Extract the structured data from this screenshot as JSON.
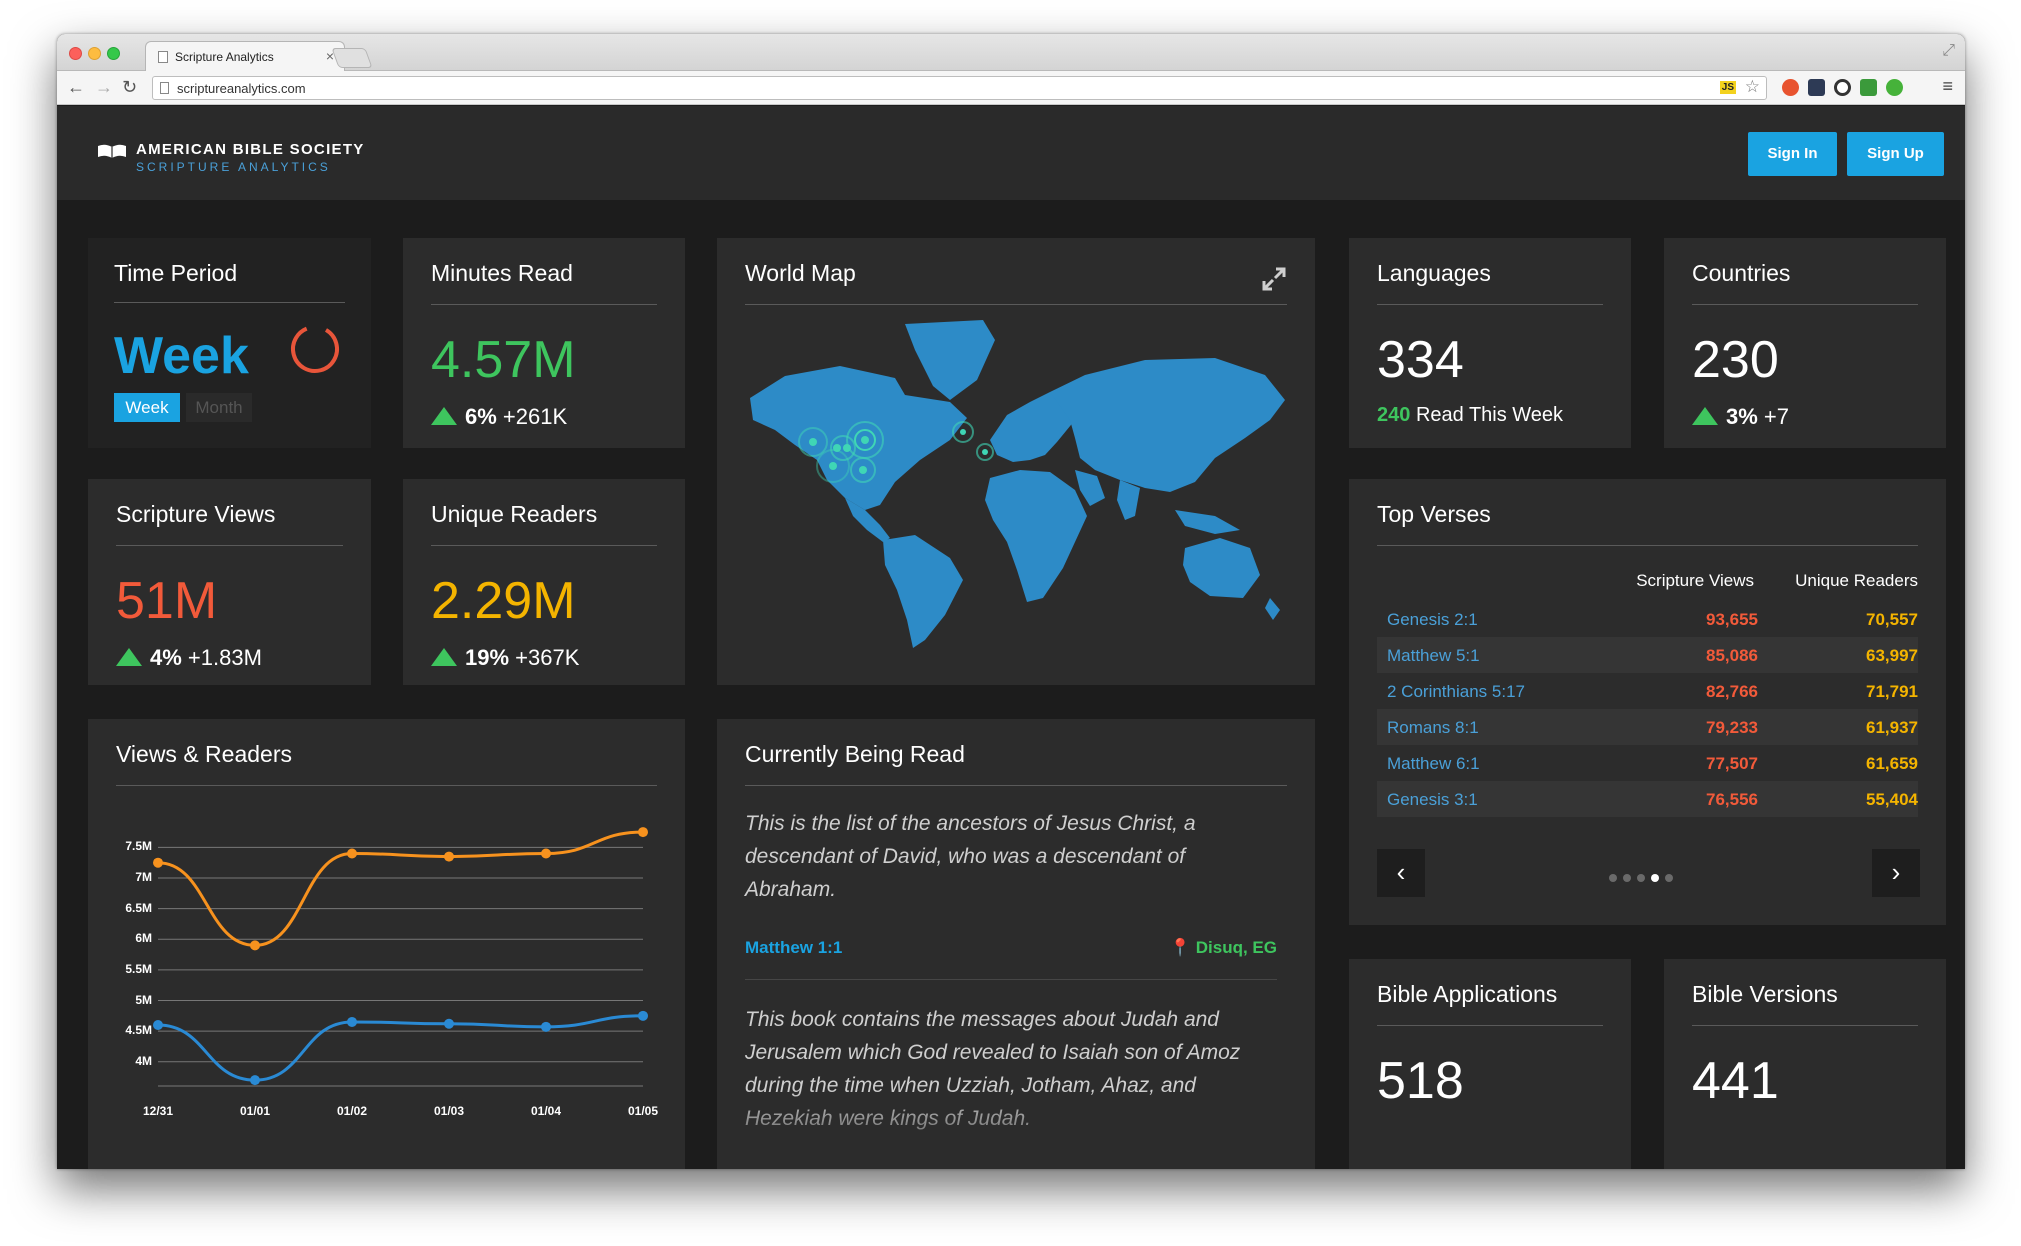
{
  "browser": {
    "tab_title": "Scripture Analytics",
    "tab_close": "×",
    "url": "scriptureanalytics.com",
    "js_badge": "JS"
  },
  "header": {
    "brand_line1": "AMERICAN BIBLE SOCIETY",
    "brand_line2": "SCRIPTURE ANALYTICS",
    "sign_in": "Sign In",
    "sign_up": "Sign Up"
  },
  "time_period": {
    "title": "Time Period",
    "value": "Week",
    "options": [
      "Week",
      "Month"
    ],
    "selected": "Week"
  },
  "minutes_read": {
    "title": "Minutes Read",
    "value": "4.57M",
    "pct": "6%",
    "change": "+261K"
  },
  "world_map": {
    "title": "World Map"
  },
  "languages": {
    "title": "Languages",
    "value": "334",
    "week_count": "240",
    "week_label": "Read This Week"
  },
  "countries": {
    "title": "Countries",
    "value": "230",
    "pct": "3%",
    "change": "+7"
  },
  "scripture_views": {
    "title": "Scripture Views",
    "value": "51M",
    "pct": "4%",
    "change": "+1.83M"
  },
  "unique_readers": {
    "title": "Unique Readers",
    "value": "2.29M",
    "pct": "19%",
    "change": "+367K"
  },
  "top_verses": {
    "title": "Top Verses",
    "col_views": "Scripture Views",
    "col_readers": "Unique Readers",
    "rows": [
      {
        "ref": "Genesis 2:1",
        "views": "93,655",
        "readers": "70,557"
      },
      {
        "ref": "Matthew 5:1",
        "views": "85,086",
        "readers": "63,997"
      },
      {
        "ref": "2 Corinthians 5:17",
        "views": "82,766",
        "readers": "71,791"
      },
      {
        "ref": "Romans 8:1",
        "views": "79,233",
        "readers": "61,937"
      },
      {
        "ref": "Matthew 6:1",
        "views": "77,507",
        "readers": "61,659"
      },
      {
        "ref": "Genesis 3:1",
        "views": "76,556",
        "readers": "55,404"
      }
    ],
    "page_count": 5,
    "page_active": 4,
    "prev": "‹",
    "next": "›"
  },
  "currently_reading": {
    "title": "Currently Being Read",
    "items": [
      {
        "text": "This is the list of the ancestors of Jesus Christ, a descendant of David, who was a descendant of Abraham.",
        "ref": "Matthew 1:1",
        "location": "Disuq, EG"
      },
      {
        "text": "This book contains the messages about Judah and Jerusalem which God revealed to Isaiah son of Amoz during the time when Uzziah, Jotham, Ahaz, and Hezekiah were kings of Judah.",
        "ref": "",
        "location": ""
      }
    ]
  },
  "bible_applications": {
    "title": "Bible Applications",
    "value": "518"
  },
  "bible_versions": {
    "title": "Bible Versions",
    "value": "441"
  },
  "views_readers": {
    "title": "Views & Readers"
  },
  "colors": {
    "accent": "#1aa3e1",
    "green": "#3ec55e",
    "red": "#f25a3a",
    "yellow": "#f4b400",
    "orange": "#f7921e",
    "blue_line": "#2a8ad4"
  },
  "chart_data": {
    "type": "line",
    "title": "Views & Readers",
    "categories": [
      "12/31",
      "01/01",
      "01/02",
      "01/03",
      "01/04",
      "01/05"
    ],
    "y_ticks": [
      "7.5M",
      "7M",
      "6.5M",
      "6M",
      "5.5M",
      "5M",
      "4.5M",
      "4M"
    ],
    "ylim": [
      3.8,
      7.8
    ],
    "grid": true,
    "series": [
      {
        "color": "#f7921e",
        "values": [
          7.25,
          5.9,
          7.4,
          7.35,
          7.4,
          7.75
        ]
      },
      {
        "color": "#2a8ad4",
        "values": [
          4.6,
          3.7,
          4.65,
          4.62,
          4.57,
          4.75
        ]
      }
    ]
  }
}
